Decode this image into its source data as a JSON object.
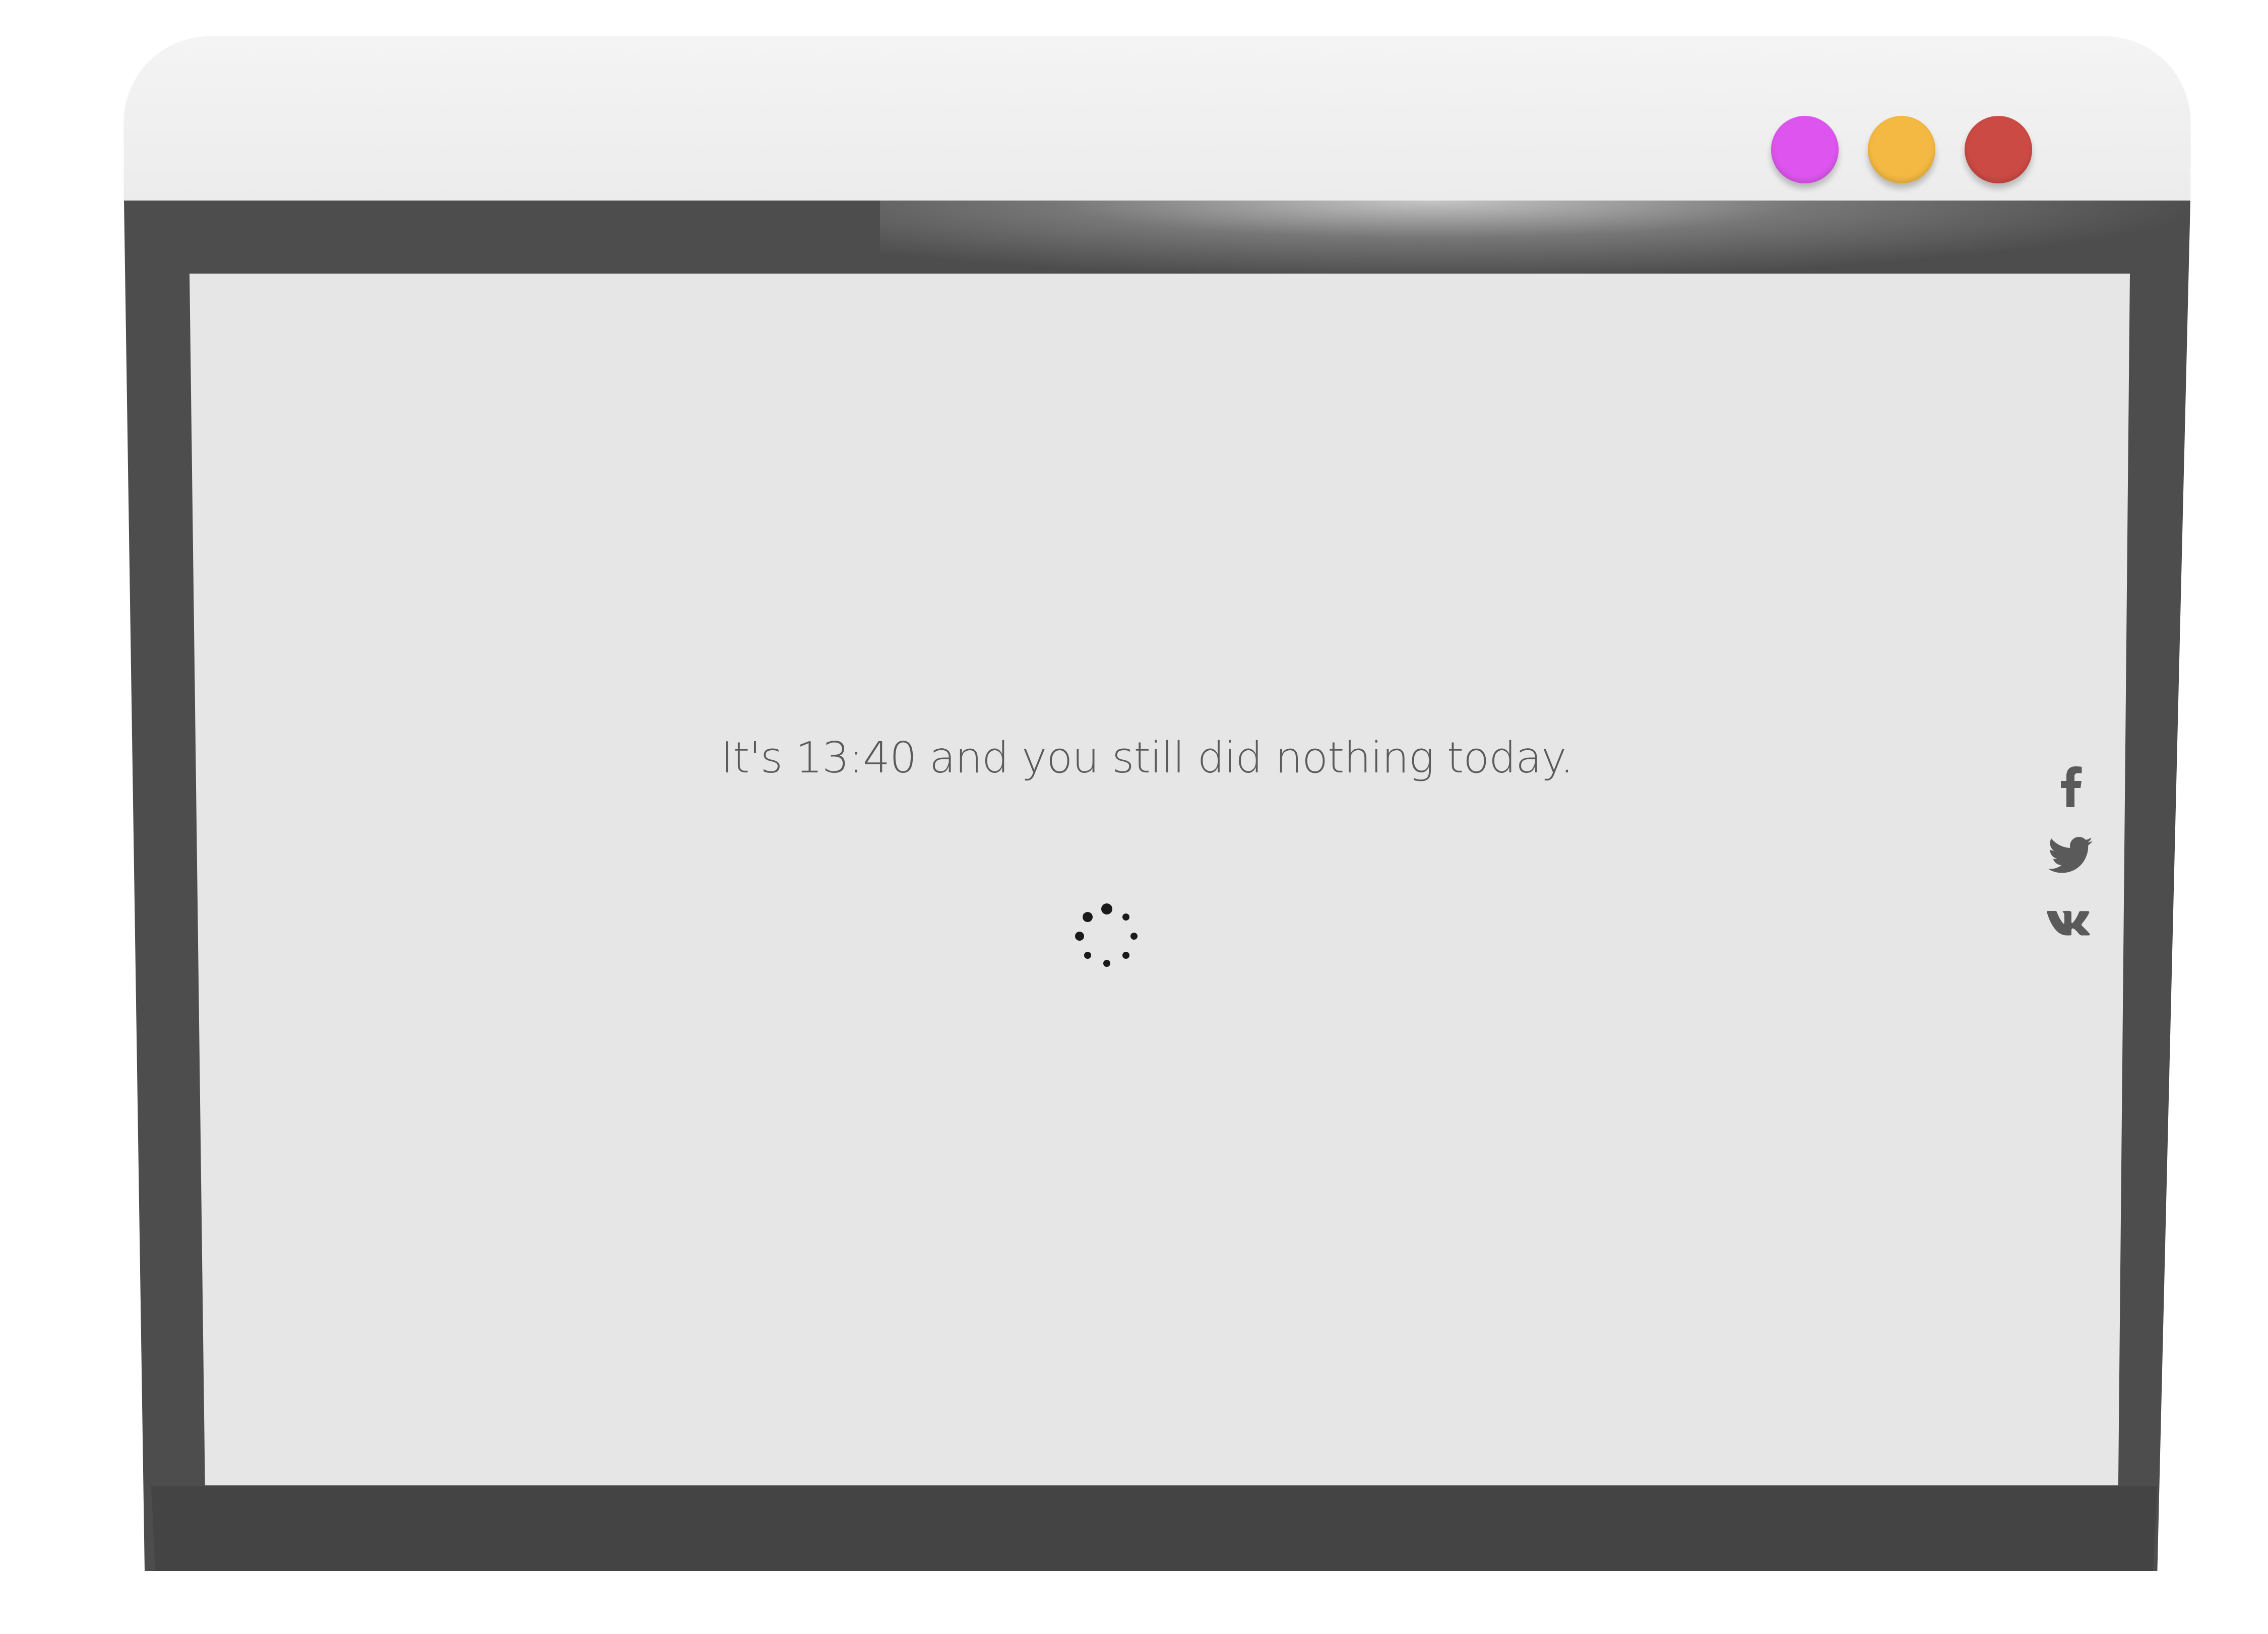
{
  "window": {
    "controls": [
      {
        "name": "purple-dot",
        "color": "#dd55ee"
      },
      {
        "name": "yellow-dot",
        "color": "#f4b942"
      },
      {
        "name": "red-dot",
        "color": "#cc4a44"
      }
    ]
  },
  "main": {
    "message": "It's 13:40 and you still did nothing today.",
    "spinner": "loading-spinner-icon"
  },
  "social": [
    {
      "icon": "facebook-icon"
    },
    {
      "icon": "twitter-icon"
    },
    {
      "icon": "vk-icon"
    }
  ],
  "colors": {
    "titlebar": "#f0f0f0",
    "frame": "#4d4d4d",
    "screen": "#e6e6e6",
    "text": "#5b5b5b",
    "icons": "#5a5a5a"
  }
}
